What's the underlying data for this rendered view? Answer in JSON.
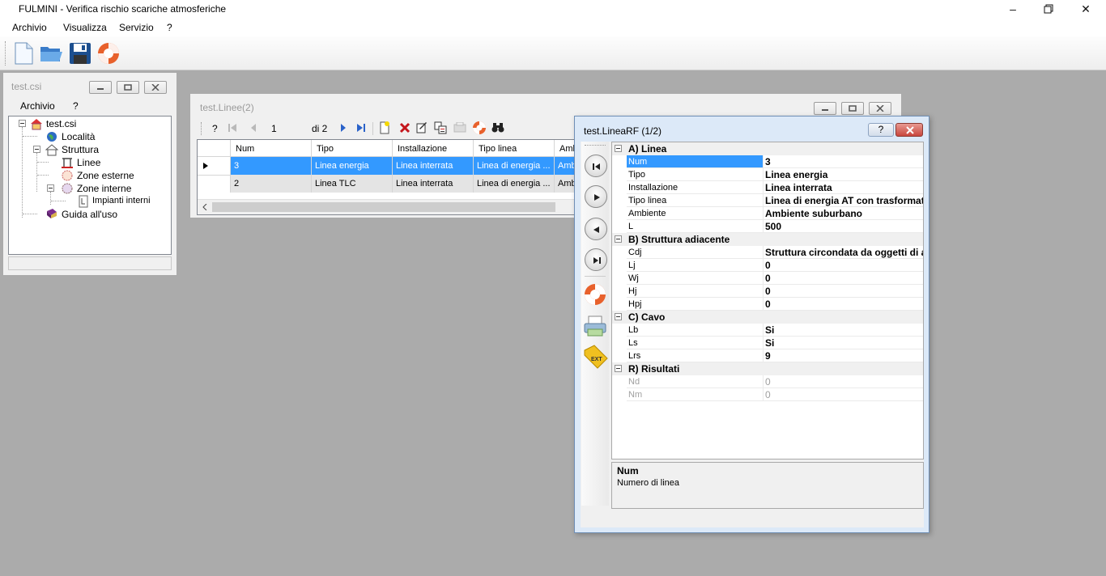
{
  "app": {
    "title": "FULMINI - Verifica rischio scariche atmosferiche",
    "menu": [
      "Archivio",
      "Visualizza",
      "Servizio",
      "?"
    ]
  },
  "toolbar": {
    "icons": [
      "new-file-icon",
      "open-folder-icon",
      "save-disk-icon",
      "lifebuoy-help-icon"
    ]
  },
  "tree_window": {
    "title": "test.csi",
    "menu": [
      "Archivio",
      "?"
    ],
    "nodes": {
      "root": "test.csi",
      "localita": "Località",
      "struttura": "Struttura",
      "linee": "Linee",
      "zone_esterne": "Zone esterne",
      "zone_interne": "Zone interne",
      "impianti_interni": "Impianti interni",
      "guida": "Guida all'uso"
    }
  },
  "linee_window": {
    "title": "test.Linee(2)",
    "nav": {
      "help": "?",
      "position": "1",
      "of": "di 2"
    },
    "columns": [
      "Num",
      "Tipo",
      "Installazione",
      "Tipo linea",
      "Amb"
    ],
    "rows": [
      [
        "3",
        "Linea energia",
        "Linea interrata",
        "Linea di energia ...",
        "Ambi"
      ],
      [
        "2",
        "Linea TLC",
        "Linea interrata",
        "Linea di energia ...",
        "Ambi"
      ]
    ]
  },
  "linearf_window": {
    "title": "test.LineaRF (1/2)",
    "categories": {
      "a": "A) Linea",
      "b": "B) Struttura adiacente",
      "c": "C) Cavo",
      "r": "R) Risultati"
    },
    "props": {
      "a": [
        {
          "name": "Num",
          "value": "3"
        },
        {
          "name": "Tipo",
          "value": "Linea energia"
        },
        {
          "name": "Installazione",
          "value": "Linea interrata"
        },
        {
          "name": "Tipo linea",
          "value": "Linea di energia AT con trasformato"
        },
        {
          "name": "Ambiente",
          "value": "Ambiente suburbano"
        },
        {
          "name": "L",
          "value": "500"
        }
      ],
      "b": [
        {
          "name": "Cdj",
          "value": "Struttura circondata da oggetti di a"
        },
        {
          "name": "Lj",
          "value": "0"
        },
        {
          "name": "Wj",
          "value": "0"
        },
        {
          "name": "Hj",
          "value": "0"
        },
        {
          "name": "Hpj",
          "value": "0"
        }
      ],
      "c": [
        {
          "name": "Lb",
          "value": "Si"
        },
        {
          "name": "Ls",
          "value": "Si"
        },
        {
          "name": "Lrs",
          "value": "9"
        }
      ],
      "r": [
        {
          "name": "Nd",
          "value": "0"
        },
        {
          "name": "Nm",
          "value": "0"
        }
      ]
    },
    "description": {
      "title": "Num",
      "text": "Numero di linea"
    },
    "side_buttons": [
      "first-record-icon",
      "next-record-icon",
      "previous-record-icon",
      "last-record-icon",
      "lifebuoy-help-icon",
      "printer-icon",
      "export-tag-icon"
    ]
  },
  "colors": {
    "mdi_background": "#ababab",
    "selection": "#3399ff",
    "close_red": "#c9463d"
  }
}
